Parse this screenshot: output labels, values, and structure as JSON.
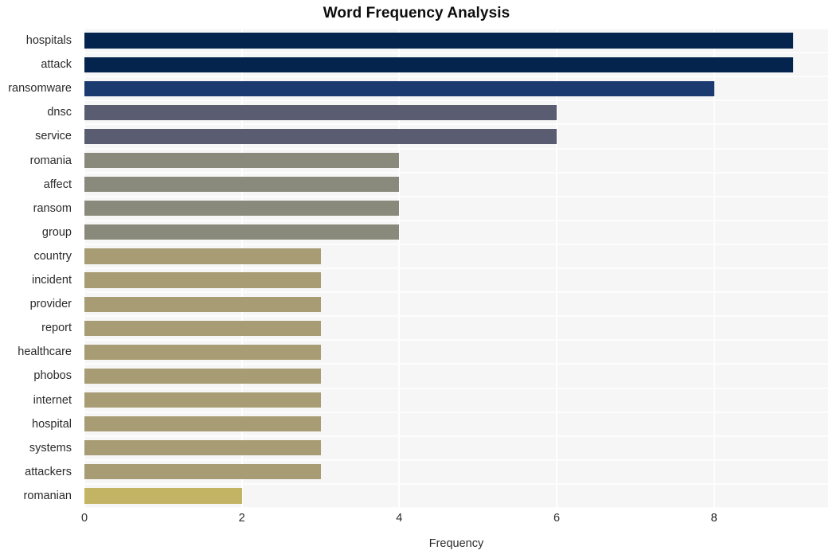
{
  "chart_data": {
    "type": "bar",
    "orientation": "horizontal",
    "title": "Word Frequency Analysis",
    "xlabel": "Frequency",
    "ylabel": "",
    "categories": [
      "hospitals",
      "attack",
      "ransomware",
      "dnsc",
      "service",
      "romania",
      "affect",
      "ransom",
      "group",
      "country",
      "incident",
      "provider",
      "report",
      "healthcare",
      "phobos",
      "internet",
      "hospital",
      "systems",
      "attackers",
      "romanian"
    ],
    "values": [
      9,
      9,
      8,
      6,
      6,
      4,
      4,
      4,
      4,
      3,
      3,
      3,
      3,
      3,
      3,
      3,
      3,
      3,
      3,
      2
    ],
    "bar_colors": [
      "#04234d",
      "#04234d",
      "#1b3a70",
      "#5a5d72",
      "#5a5d72",
      "#8a8a7c",
      "#8a8a7c",
      "#8a8a7c",
      "#8a8a7c",
      "#a79c73",
      "#a79c73",
      "#a79c73",
      "#a79c73",
      "#a79c73",
      "#a79c73",
      "#a79c73",
      "#a79c73",
      "#a79c73",
      "#a79c73",
      "#c3b464"
    ],
    "xlim": [
      0,
      9.45
    ],
    "xticks": [
      0,
      2,
      4,
      6,
      8
    ],
    "xtick_labels": [
      "0",
      "2",
      "4",
      "6",
      "8"
    ],
    "grid": true,
    "grid_color": "#ffffff",
    "plot_background": "#f6f6f7",
    "figure_background": "#ffffff",
    "legend": false
  }
}
